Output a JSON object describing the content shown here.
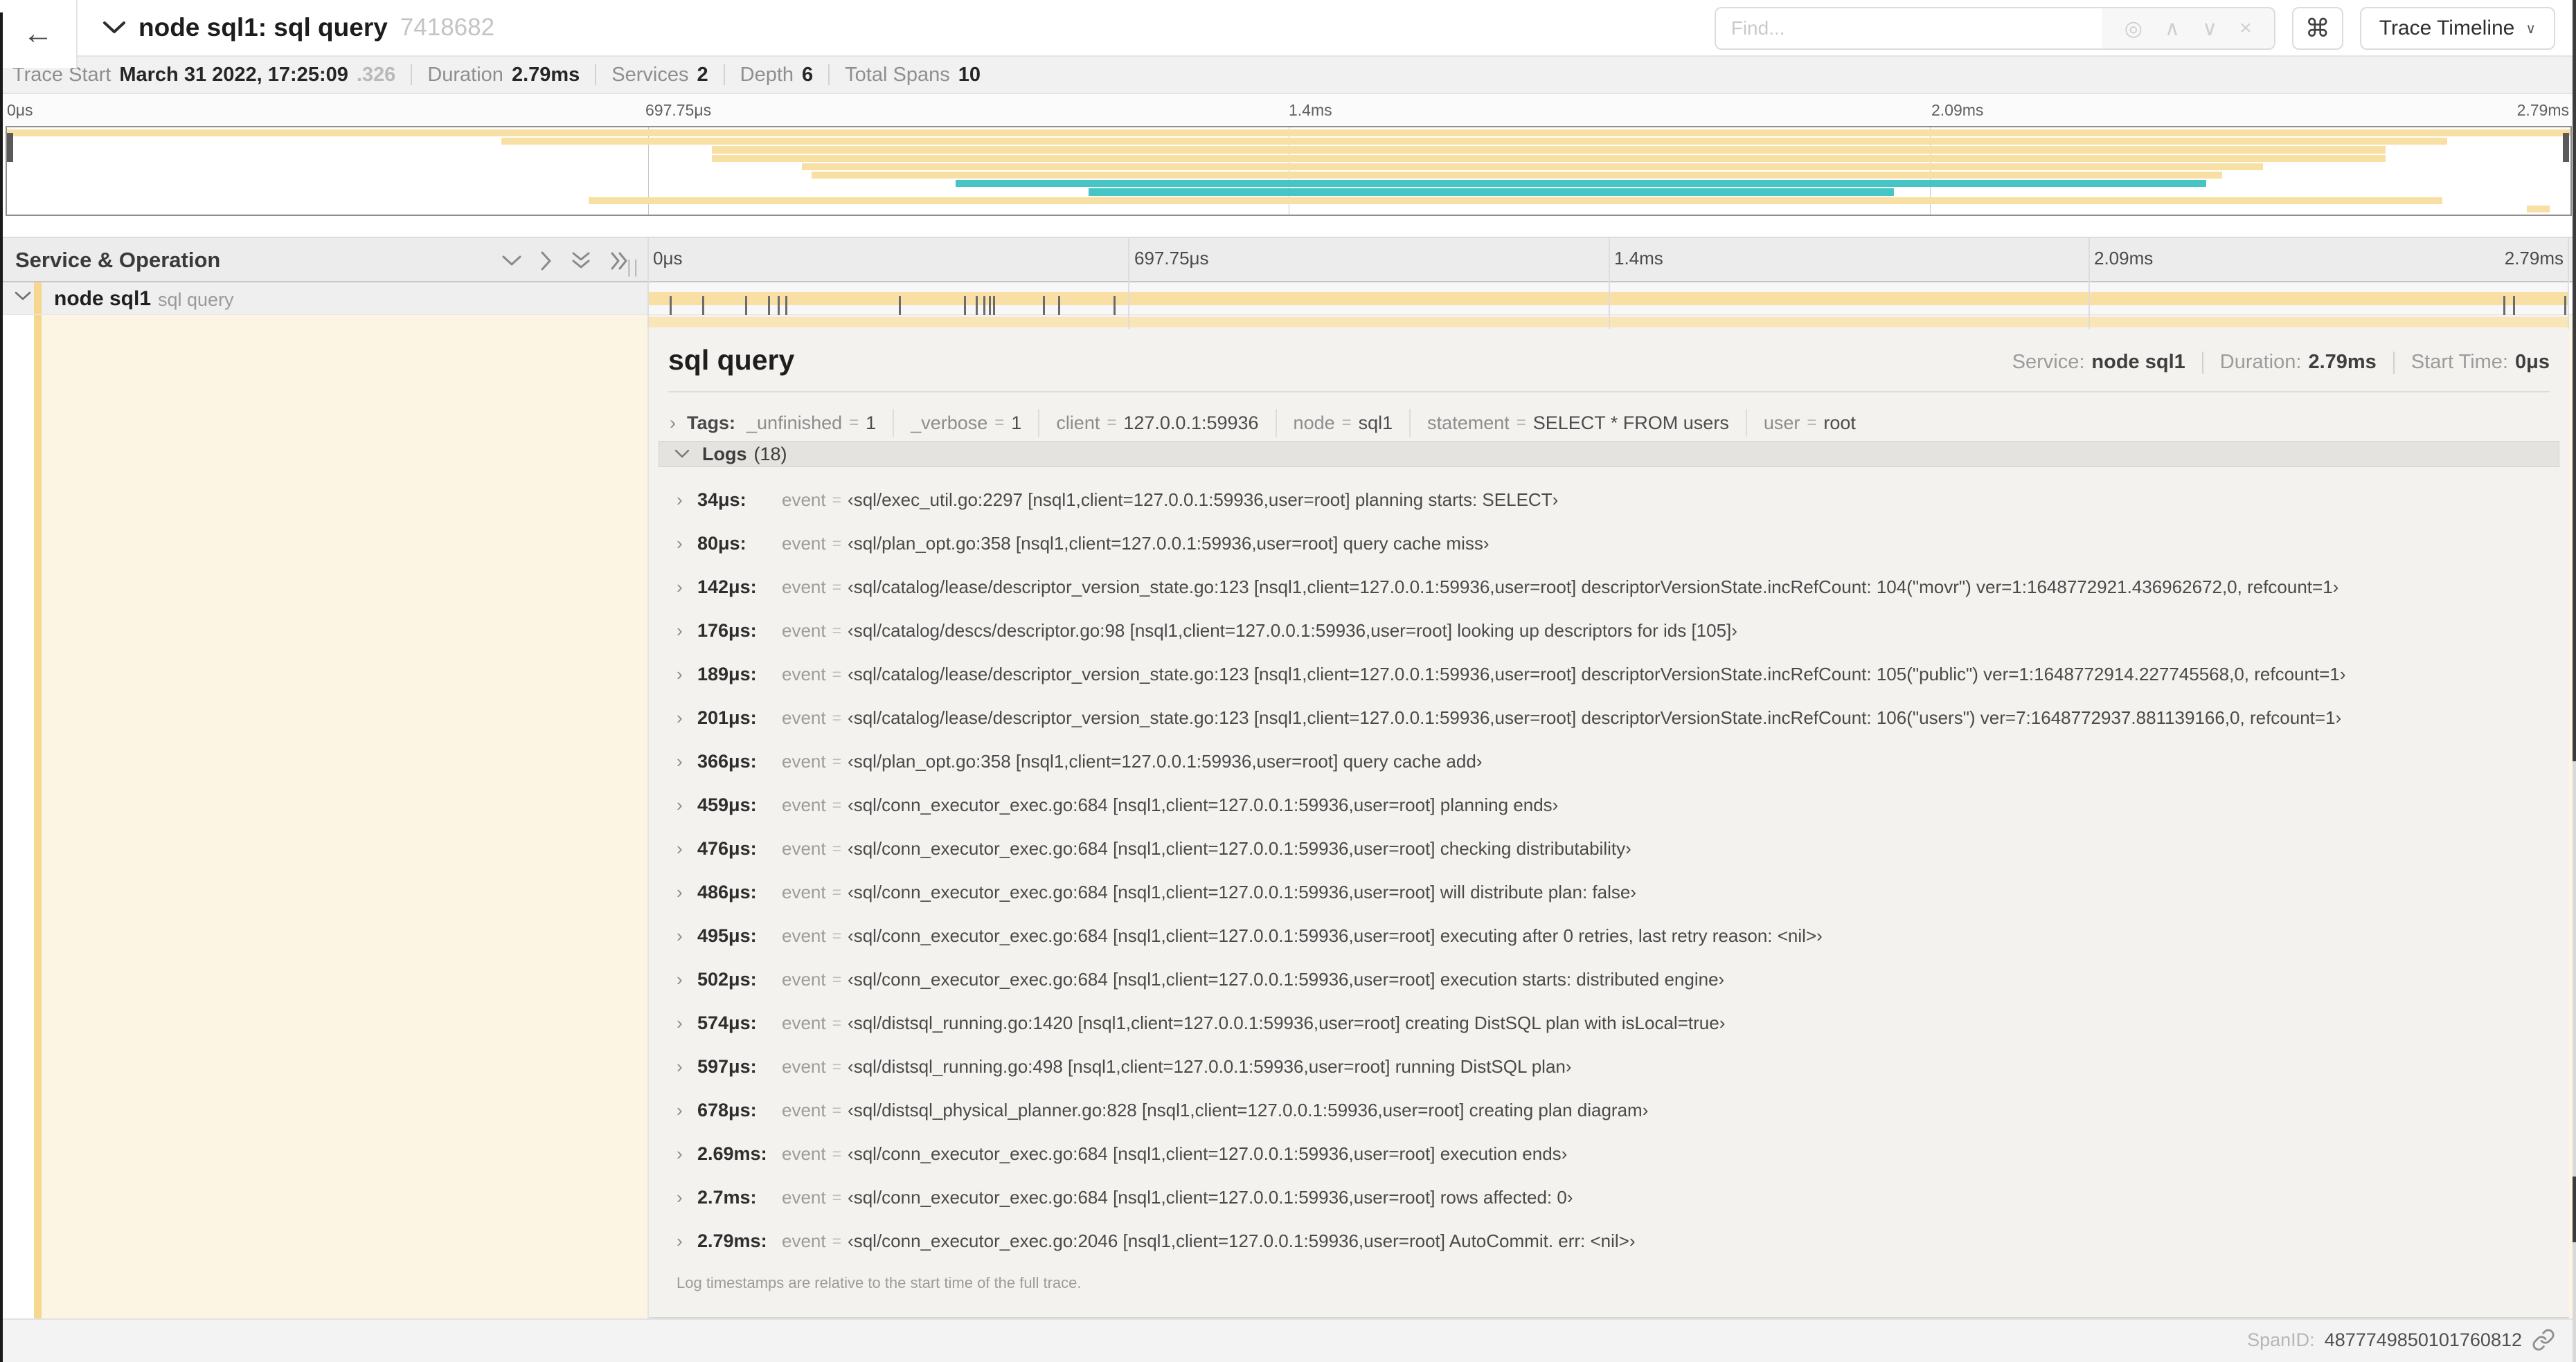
{
  "colors": {
    "tan": "#f8dfa4",
    "tan_faded": "#f9e5b6",
    "tan_strip": "#f5d78e",
    "teal": "#45c6c5",
    "cream": "#fcf5e4"
  },
  "header": {
    "back_icon": "←",
    "title": "node sql1: sql query",
    "trace_id": "7418682",
    "find_placeholder": "Find...",
    "find_icons": {
      "locate": "◎",
      "prev": "∧",
      "next": "∨",
      "clear": "×"
    },
    "shortcut_button": "⌘",
    "view_button": "Trace Timeline",
    "view_caret": "∨"
  },
  "summary": {
    "items": [
      {
        "label": "Trace Start",
        "value": "March 31 2022, 17:25:09",
        "suffix": ".326"
      },
      {
        "label": "Duration",
        "value": "2.79ms",
        "suffix": ""
      },
      {
        "label": "Services",
        "value": "2",
        "suffix": ""
      },
      {
        "label": "Depth",
        "value": "6",
        "suffix": ""
      },
      {
        "label": "Total Spans",
        "value": "10",
        "suffix": ""
      }
    ]
  },
  "minimap": {
    "time_labels": [
      "0μs",
      "697.75μs",
      "1.4ms",
      "2.09ms",
      "2.79ms"
    ],
    "spans": [
      {
        "start": 0,
        "end": 100,
        "color": "tan"
      },
      {
        "start": 19.3,
        "end": 95.2,
        "color": "tan"
      },
      {
        "start": 27.5,
        "end": 92.8,
        "color": "tan"
      },
      {
        "start": 27.5,
        "end": 92.8,
        "color": "tan"
      },
      {
        "start": 31.0,
        "end": 88.0,
        "color": "tan"
      },
      {
        "start": 31.4,
        "end": 86.4,
        "color": "tan"
      },
      {
        "start": 37.0,
        "end": 85.8,
        "color": "teal"
      },
      {
        "start": 42.2,
        "end": 73.6,
        "color": "teal"
      },
      {
        "start": 22.7,
        "end": 95.0,
        "color": "tan"
      },
      {
        "start": 98.3,
        "end": 99.2,
        "color": "tan"
      }
    ]
  },
  "timeline_header": {
    "title": "Service & Operation",
    "time_labels": [
      "0μs",
      "697.75μs",
      "1.4ms",
      "2.09ms",
      "2.79ms"
    ],
    "resize_grip": "||"
  },
  "span_row": {
    "service": "node sql1",
    "operation": "sql query",
    "ticks_pct": [
      1.2,
      2.9,
      5.1,
      6.3,
      6.8,
      7.2,
      13.1,
      16.5,
      17.1,
      17.5,
      17.8,
      18.0,
      20.6,
      21.4,
      24.3,
      96.6,
      97.1,
      99.8
    ]
  },
  "detail": {
    "operation": "sql query",
    "meta": [
      {
        "label": "Service:",
        "value": "node sql1"
      },
      {
        "label": "Duration:",
        "value": "2.79ms"
      },
      {
        "label": "Start Time:",
        "value": "0μs"
      }
    ],
    "tags_label": "Tags:",
    "tags": [
      {
        "key": "_unfinished",
        "value": "1"
      },
      {
        "key": "_verbose",
        "value": "1"
      },
      {
        "key": "client",
        "value": "127.0.0.1:59936"
      },
      {
        "key": "node",
        "value": "sql1"
      },
      {
        "key": "statement",
        "value": "SELECT * FROM users"
      },
      {
        "key": "user",
        "value": "root"
      }
    ],
    "logs_label": "Logs",
    "logs_count": "(18)",
    "log_field_key": "event",
    "logs": [
      {
        "time": "34μs:",
        "value": "‹sql/exec_util.go:2297 [nsql1,client=127.0.0.1:59936,user=root] planning starts: SELECT›"
      },
      {
        "time": "80μs:",
        "value": "‹sql/plan_opt.go:358 [nsql1,client=127.0.0.1:59936,user=root] query cache miss›"
      },
      {
        "time": "142μs:",
        "value": "‹sql/catalog/lease/descriptor_version_state.go:123 [nsql1,client=127.0.0.1:59936,user=root] descriptorVersionState.incRefCount: 104(\"movr\") ver=1:1648772921.436962672,0, refcount=1›"
      },
      {
        "time": "176μs:",
        "value": "‹sql/catalog/descs/descriptor.go:98 [nsql1,client=127.0.0.1:59936,user=root] looking up descriptors for ids [105]›"
      },
      {
        "time": "189μs:",
        "value": "‹sql/catalog/lease/descriptor_version_state.go:123 [nsql1,client=127.0.0.1:59936,user=root] descriptorVersionState.incRefCount: 105(\"public\") ver=1:1648772914.227745568,0, refcount=1›"
      },
      {
        "time": "201μs:",
        "value": "‹sql/catalog/lease/descriptor_version_state.go:123 [nsql1,client=127.0.0.1:59936,user=root] descriptorVersionState.incRefCount: 106(\"users\") ver=7:1648772937.881139166,0, refcount=1›"
      },
      {
        "time": "366μs:",
        "value": "‹sql/plan_opt.go:358 [nsql1,client=127.0.0.1:59936,user=root] query cache add›"
      },
      {
        "time": "459μs:",
        "value": "‹sql/conn_executor_exec.go:684 [nsql1,client=127.0.0.1:59936,user=root] planning ends›"
      },
      {
        "time": "476μs:",
        "value": "‹sql/conn_executor_exec.go:684 [nsql1,client=127.0.0.1:59936,user=root] checking distributability›"
      },
      {
        "time": "486μs:",
        "value": "‹sql/conn_executor_exec.go:684 [nsql1,client=127.0.0.1:59936,user=root] will distribute plan: false›"
      },
      {
        "time": "495μs:",
        "value": "‹sql/conn_executor_exec.go:684 [nsql1,client=127.0.0.1:59936,user=root] executing after 0 retries, last retry reason: <nil>›"
      },
      {
        "time": "502μs:",
        "value": "‹sql/conn_executor_exec.go:684 [nsql1,client=127.0.0.1:59936,user=root] execution starts: distributed engine›"
      },
      {
        "time": "574μs:",
        "value": "‹sql/distsql_running.go:1420 [nsql1,client=127.0.0.1:59936,user=root] creating DistSQL plan with isLocal=true›"
      },
      {
        "time": "597μs:",
        "value": "‹sql/distsql_running.go:498 [nsql1,client=127.0.0.1:59936,user=root] running DistSQL plan›"
      },
      {
        "time": "678μs:",
        "value": "‹sql/distsql_physical_planner.go:828 [nsql1,client=127.0.0.1:59936,user=root] creating plan diagram›"
      },
      {
        "time": "2.69ms:",
        "value": "‹sql/conn_executor_exec.go:684 [nsql1,client=127.0.0.1:59936,user=root] execution ends›"
      },
      {
        "time": "2.7ms:",
        "value": "‹sql/conn_executor_exec.go:684 [nsql1,client=127.0.0.1:59936,user=root] rows affected: 0›"
      },
      {
        "time": "2.79ms:",
        "value": "‹sql/conn_executor_exec.go:2046 [nsql1,client=127.0.0.1:59936,user=root] AutoCommit. err: <nil>›"
      }
    ],
    "logs_note": "Log timestamps are relative to the start time of the full trace.",
    "span_id_label": "SpanID:",
    "span_id": "4877749850101760812"
  }
}
